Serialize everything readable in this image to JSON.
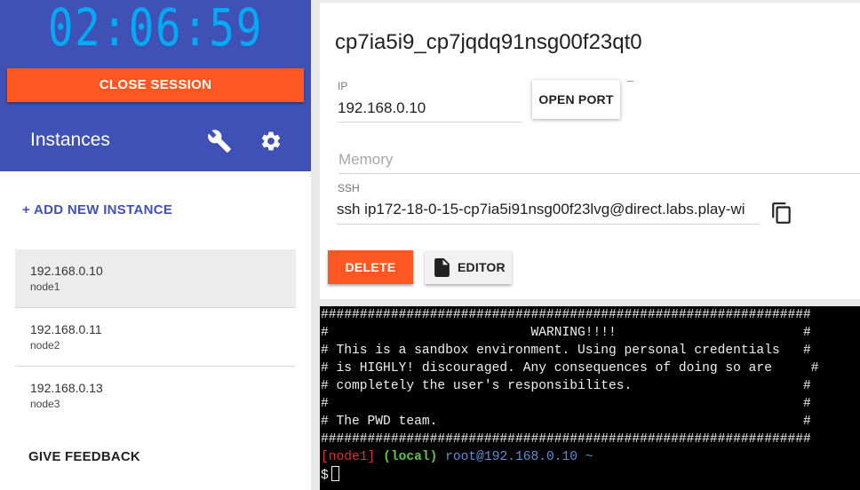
{
  "sidebar": {
    "timer": "02:06:59",
    "close_session_label": "CLOSE SESSION",
    "instances_title": "Instances",
    "add_instance_label": "+ ADD NEW INSTANCE",
    "instances": [
      {
        "ip": "192.168.0.10",
        "name": "node1",
        "selected": true
      },
      {
        "ip": "192.168.0.11",
        "name": "node2",
        "selected": false
      },
      {
        "ip": "192.168.0.13",
        "name": "node3",
        "selected": false
      }
    ],
    "feedback_label": "GIVE FEEDBACK",
    "icons": [
      "wrench-icon",
      "gear-icon"
    ]
  },
  "main": {
    "session_title": "cp7ia5i9_cp7jqdq91nsg00f23qt0",
    "ip_label": "IP",
    "ip_value": "192.168.0.10",
    "open_port_label": "OPEN PORT",
    "memory_label": "Memory",
    "ssh_label": "SSH",
    "ssh_value": "ssh ip172-18-0-15-cp7ia5i91nsg00f23lvg@direct.labs.play-wi",
    "delete_label": "DELETE",
    "editor_label": "EDITOR",
    "icons": [
      "copy-icon",
      "file-icon"
    ]
  },
  "terminal": {
    "lines": [
      "###############################################################",
      "#                          WARNING!!!!                        #",
      "# This is a sandbox environment. Using personal credentials   #",
      "# is HIGHLY! discouraged. Any consequences of doing so are     #",
      "# completely the user's responsibilites.                      #",
      "#                                                             #",
      "# The PWD team.                                               #",
      "###############################################################"
    ],
    "prompt_node": "[node1]",
    "prompt_local": "(local)",
    "prompt_user": "root@192.168.0.10 ~",
    "prompt_symbol": "$"
  },
  "colors": {
    "sidebar_header": "#3f51b5",
    "timer": "#03a9f4",
    "accent": "#ff5722",
    "link": "#3f51b5",
    "terminal_bg": "#000000"
  }
}
